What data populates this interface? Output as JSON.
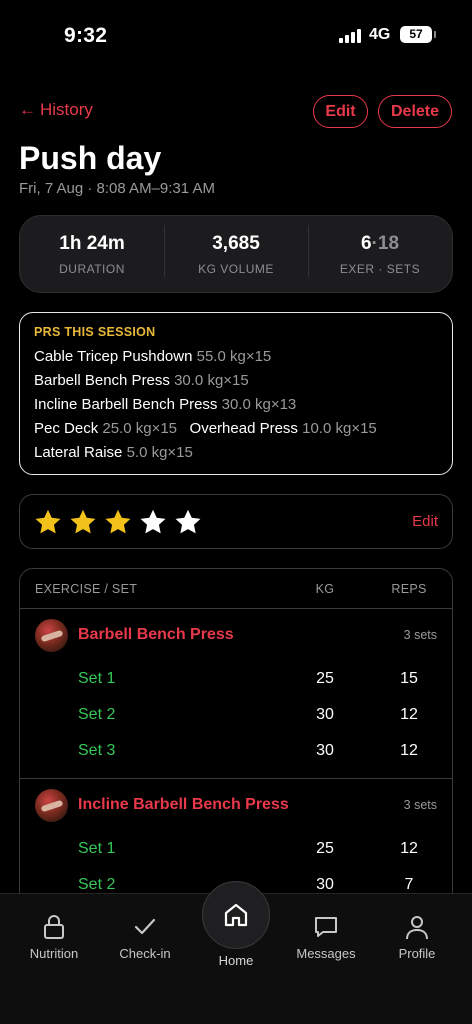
{
  "status_bar": {
    "time": "9:32",
    "network": "4G",
    "battery": "57"
  },
  "header": {
    "back_label": "History",
    "edit_label": "Edit",
    "delete_label": "Delete",
    "title": "Push day",
    "subtitle": "Fri, 7 Aug · 8:08 AM–9:31 AM"
  },
  "stats": [
    {
      "value": "1h 24m",
      "label": "DURATION"
    },
    {
      "value": "3,685",
      "label": "KG VOLUME"
    },
    {
      "value_main": "6",
      "value_sep": "·",
      "value_dim": "18",
      "label": "EXER · SETS"
    }
  ],
  "prs": {
    "heading": "PRS THIS SESSION",
    "lines": [
      [
        {
          "name": "Cable Tricep Pushdown",
          "weight": "55.0 kg×15"
        }
      ],
      [
        {
          "name": "Barbell Bench Press",
          "weight": "30.0 kg×15"
        }
      ],
      [
        {
          "name": "Incline Barbell Bench Press",
          "weight": "30.0 kg×13"
        }
      ],
      [
        {
          "name": "Pec Deck",
          "weight": "25.0 kg×15"
        },
        {
          "name": "Overhead Press",
          "weight": "10.0 kg×15"
        }
      ],
      [
        {
          "name": "Lateral Raise",
          "weight": "5.0 kg×15"
        }
      ]
    ]
  },
  "rating": {
    "value": 3,
    "max": 5,
    "edit_label": "Edit",
    "filled_color": "#f2c21b",
    "empty_color": "#ffffff"
  },
  "table": {
    "col_exercise": "EXERCISE / SET",
    "col_kg": "KG",
    "col_reps": "REPS",
    "exercises": [
      {
        "name": "Barbell Bench Press",
        "sets_label": "3 sets",
        "sets": [
          {
            "label": "Set 1",
            "kg": "25",
            "reps": "15"
          },
          {
            "label": "Set 2",
            "kg": "30",
            "reps": "12"
          },
          {
            "label": "Set 3",
            "kg": "30",
            "reps": "12"
          }
        ]
      },
      {
        "name": "Incline Barbell Bench Press",
        "sets_label": "3 sets",
        "sets": [
          {
            "label": "Set 1",
            "kg": "25",
            "reps": "12"
          },
          {
            "label": "Set 2",
            "kg": "30",
            "reps": "7"
          }
        ]
      }
    ]
  },
  "nav": {
    "items": [
      {
        "label": "Nutrition",
        "icon": "lock-icon"
      },
      {
        "label": "Check-in",
        "icon": "check-icon"
      },
      {
        "label": "Home",
        "icon": "home-icon"
      },
      {
        "label": "Messages",
        "icon": "chat-icon"
      },
      {
        "label": "Profile",
        "icon": "person-icon"
      }
    ]
  },
  "colors": {
    "accent": "#e8394b",
    "set_green": "#35c759",
    "pr_heading": "#e8b83a"
  }
}
